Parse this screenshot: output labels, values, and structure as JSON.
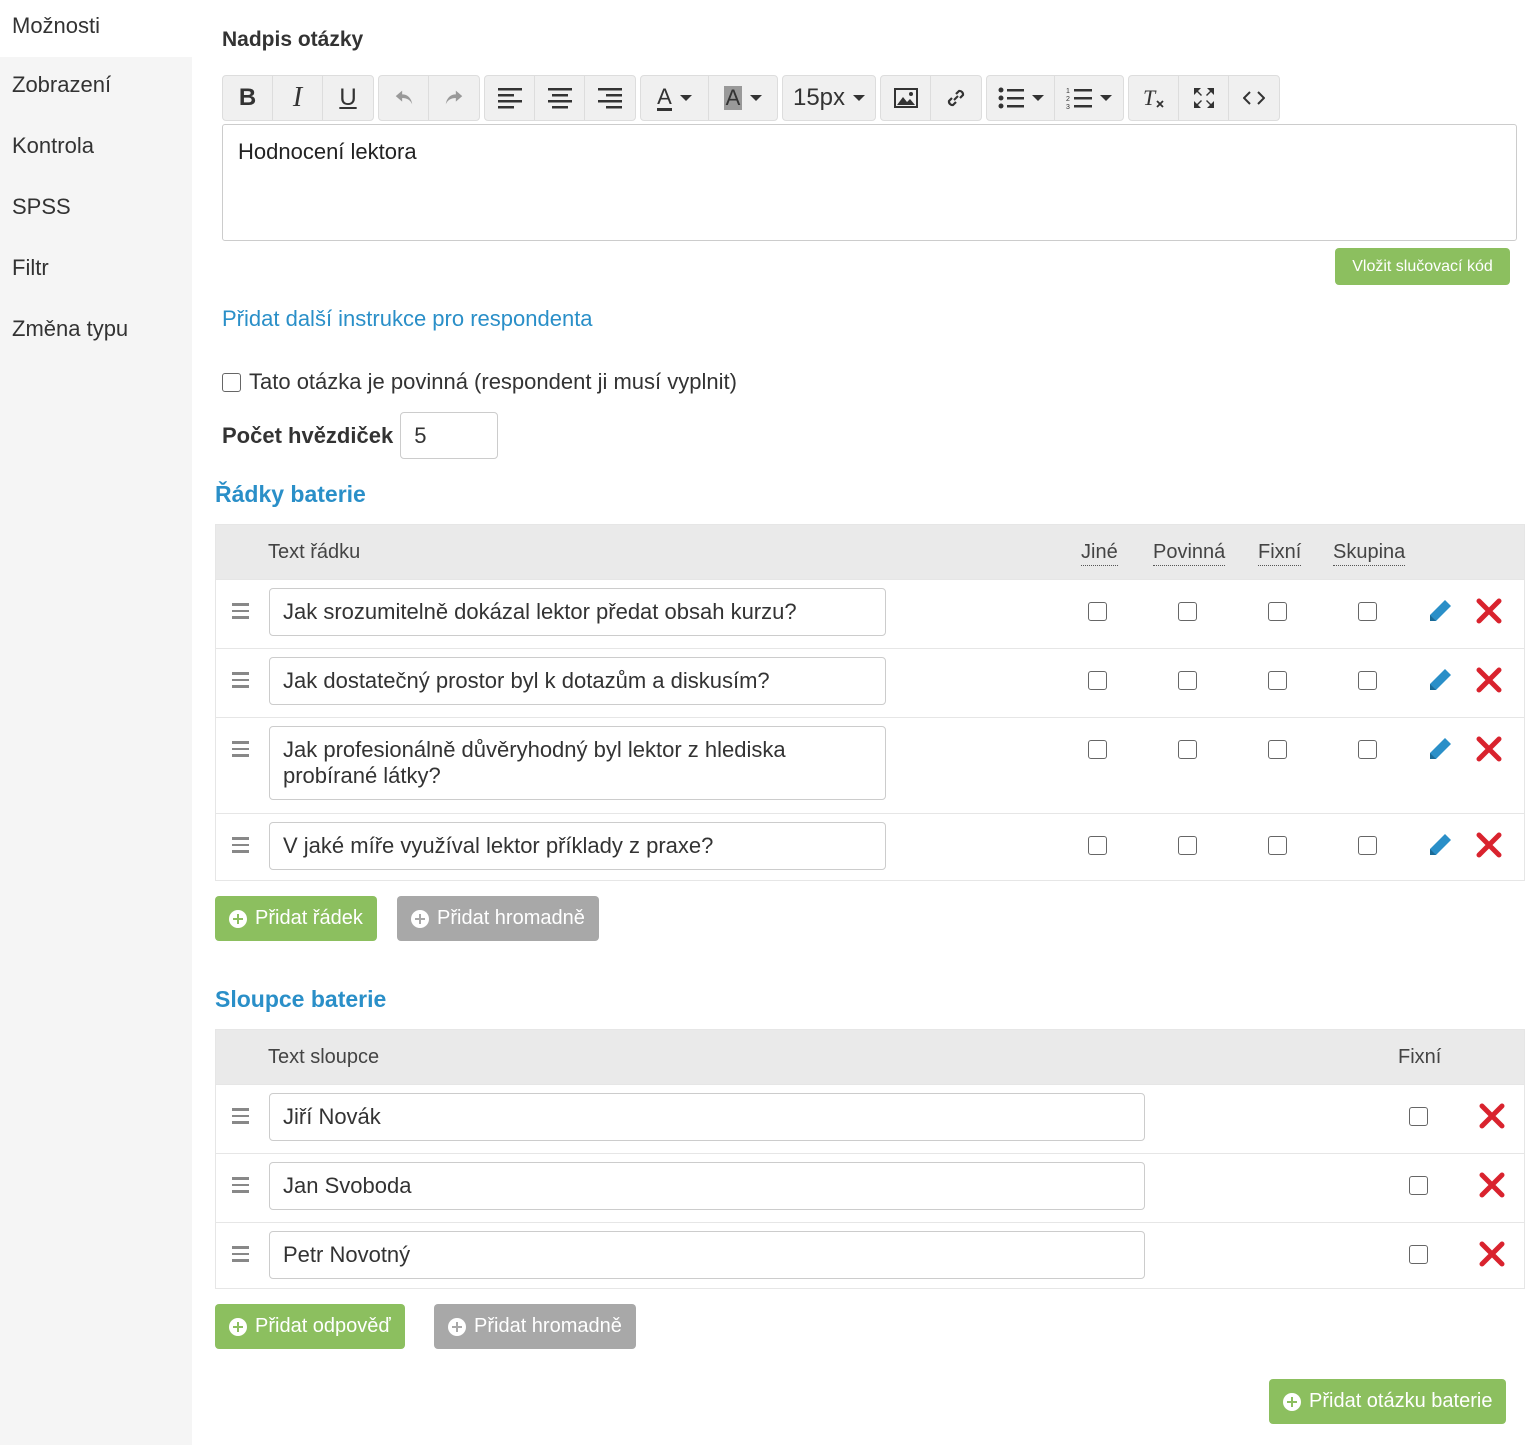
{
  "sidebar": {
    "items": [
      {
        "label": "Možnosti"
      },
      {
        "label": "Zobrazení"
      },
      {
        "label": "Kontrola"
      },
      {
        "label": "SPSS"
      },
      {
        "label": "Filtr"
      },
      {
        "label": "Změna typu"
      }
    ]
  },
  "heading": {
    "label": "Nadpis otázky"
  },
  "toolbar": {
    "font_size": "15px",
    "icons": [
      "bold-icon",
      "italic-icon",
      "underline-icon",
      "undo-icon",
      "redo-icon",
      "align-left-icon",
      "align-center-icon",
      "align-right-icon",
      "text-color-icon",
      "highlight-icon",
      "image-icon",
      "link-icon",
      "bullet-list-icon",
      "numbered-list-icon",
      "clear-format-icon",
      "fullscreen-icon",
      "code-view-icon"
    ],
    "bold": "B",
    "italic": "I",
    "underline": "U",
    "text_color": "A",
    "highlight": "A"
  },
  "editor": {
    "content": "Hodnocení lektora"
  },
  "merge_button": "Vložit slučovací kód",
  "instructions_link": "Přidat další instrukce pro respondenta",
  "required": {
    "label": "Tato otázka je povinná (respondent ji musí vyplnit)",
    "checked": false
  },
  "stars": {
    "label": "Počet hvězdiček",
    "value": "5"
  },
  "rows_section": {
    "title": "Řádky baterie",
    "headers": {
      "text": "Text řádku",
      "other": "Jiné",
      "required": "Povinná",
      "fixed": "Fixní",
      "group": "Skupina"
    },
    "rows": [
      {
        "text": "Jak srozumitelně dokázal lektor předat obsah kurzu?"
      },
      {
        "text": "Jak dostatečný prostor byl k dotazům a diskusím?"
      },
      {
        "text": "Jak profesionálně důvěryhodný byl lektor z hlediska probírané látky?"
      },
      {
        "text": "V jaké míře využíval lektor příklady z praxe?"
      }
    ],
    "add_button": "Přidat řádek",
    "bulk_button": "Přidat hromadně"
  },
  "columns_section": {
    "title": "Sloupce baterie",
    "headers": {
      "text": "Text sloupce",
      "fixed": "Fixní"
    },
    "rows": [
      {
        "text": "Jiří Novák"
      },
      {
        "text": "Jan Svoboda"
      },
      {
        "text": "Petr Novotný"
      }
    ],
    "add_button": "Přidat odpověď",
    "bulk_button": "Přidat hromadně"
  },
  "add_question_button": "Přidat otázku baterie",
  "colors": {
    "accent_blue": "#2a8fc8",
    "green": "#8cbf5f",
    "gray": "#a8a8a8",
    "delete_red": "#d9232e",
    "edit_blue": "#2a8fc8"
  }
}
